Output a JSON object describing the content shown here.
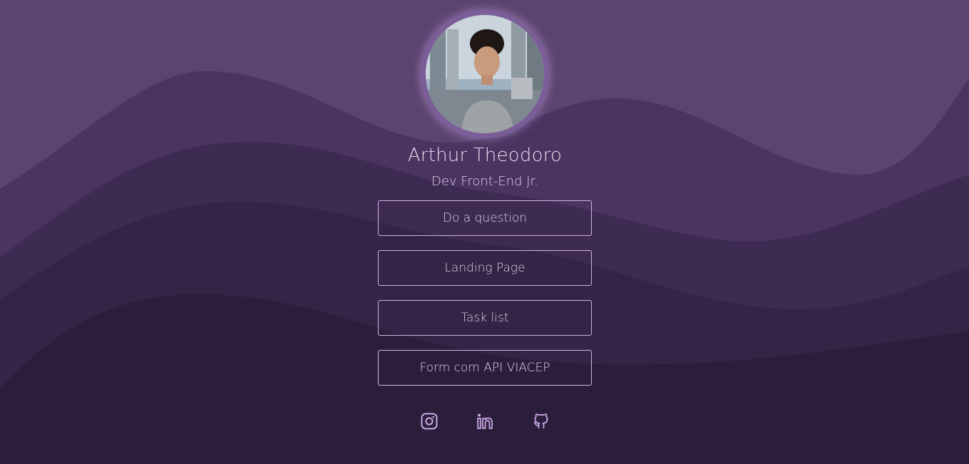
{
  "profile": {
    "name": "Arthur Theodoro",
    "role": "Dev Front-End Jr."
  },
  "links": [
    {
      "label": "Do a question"
    },
    {
      "label": "Landing Page"
    },
    {
      "label": "Task list"
    },
    {
      "label": "Form com API VIACEP"
    }
  ],
  "social": [
    {
      "icon": "instagram-icon"
    },
    {
      "icon": "linkedin-icon"
    },
    {
      "icon": "github-icon"
    }
  ],
  "colors": {
    "background_top": "#5c4470",
    "wave_1": "#4a3460",
    "wave_2": "#3e2b52",
    "wave_3": "#342446",
    "wave_4": "#2b1e3a",
    "button_border": "#cdb6e0",
    "icon": "#c9a9e6",
    "text": "#ddd0e6"
  }
}
